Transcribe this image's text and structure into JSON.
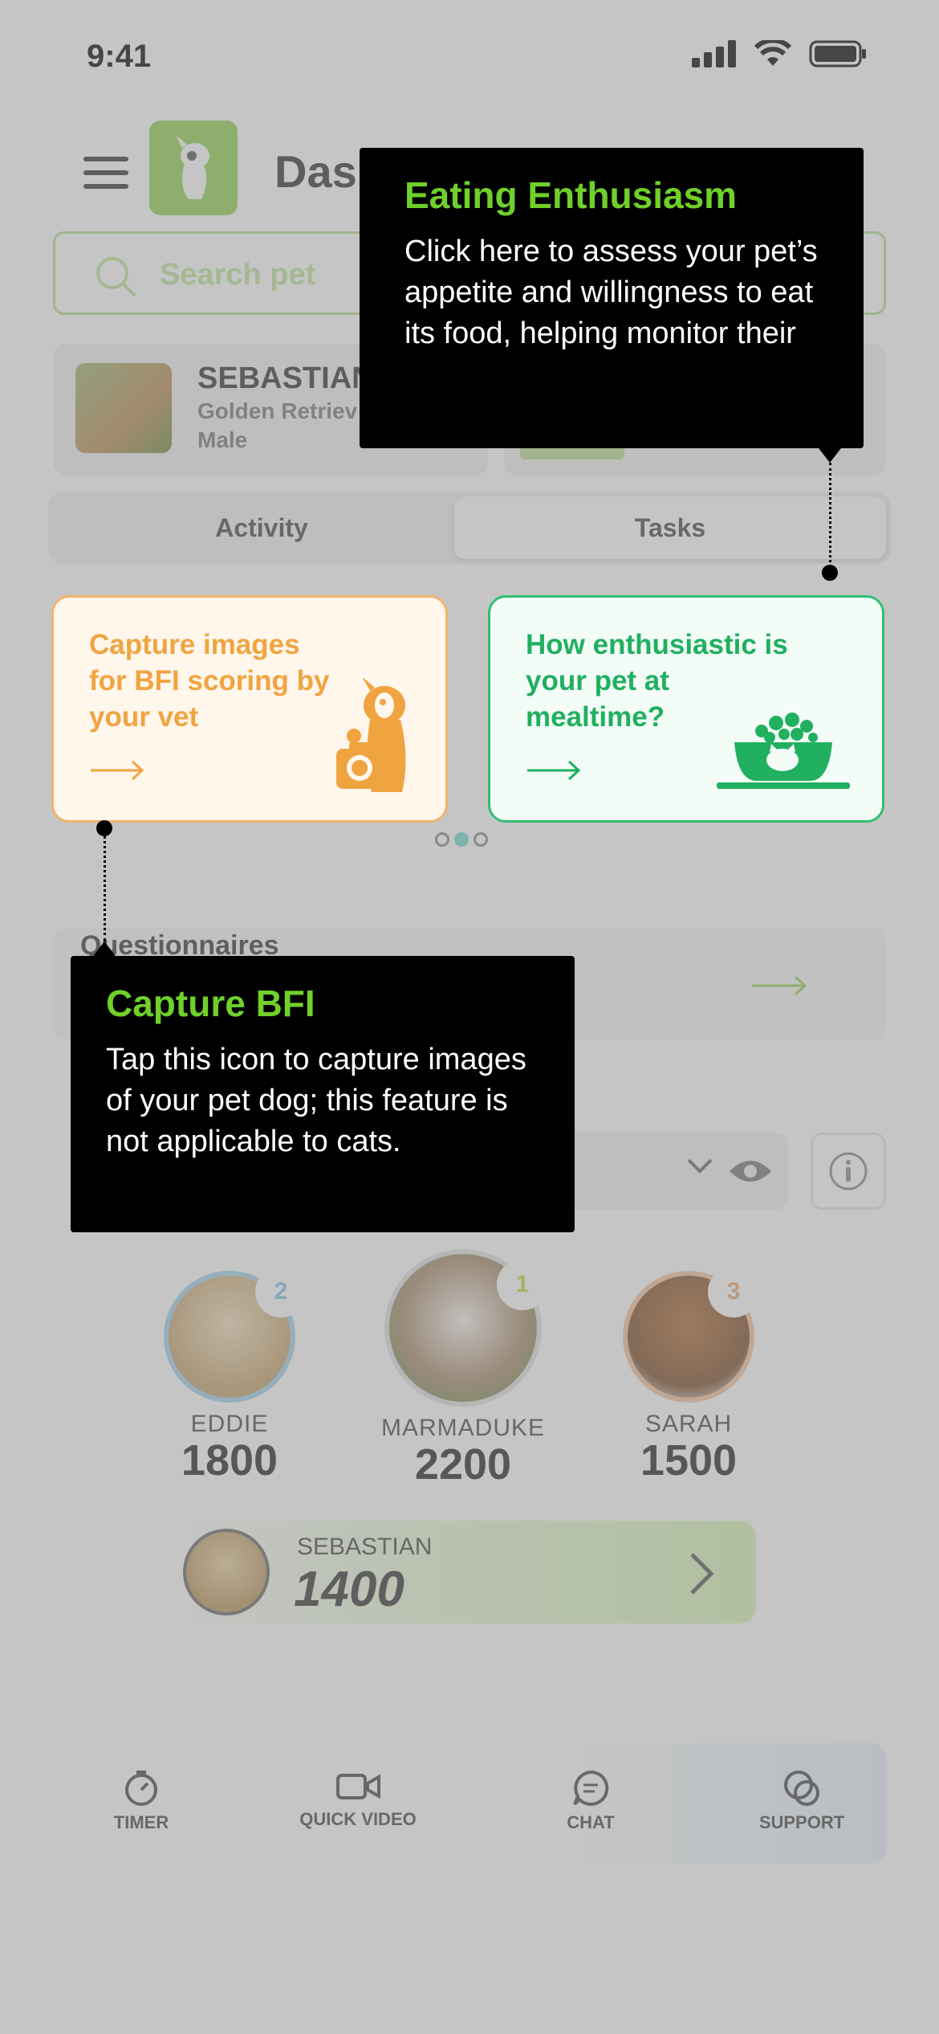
{
  "status_bar": {
    "time": "9:41"
  },
  "header": {
    "title": "Dashboard",
    "title_visible": "Dash"
  },
  "search": {
    "placeholder": "Search pet"
  },
  "pet_card": {
    "name": "SEBASTIAN",
    "breed": "Golden Retriev",
    "sex": "Male"
  },
  "tabs": [
    {
      "label": "Activity"
    },
    {
      "label": "Tasks"
    }
  ],
  "feature_cards": [
    {
      "text": "Capture images for BFI scoring by your vet",
      "accent": "#f0a440"
    },
    {
      "text": "How enthusiastic is your pet at mealtime?",
      "accent": "#20b060"
    }
  ],
  "carousel": {
    "pages": 3,
    "active_page": 2
  },
  "questionnaires": {
    "title": "Questionnaires"
  },
  "leaderboard": [
    {
      "rank": "2",
      "name": "EDDIE",
      "score": "1800"
    },
    {
      "rank": "1",
      "name": "MARMADUKE",
      "score": "2200"
    },
    {
      "rank": "3",
      "name": "SARAH",
      "score": "1500"
    }
  ],
  "current_user": {
    "name": "SEBASTIAN",
    "score": "1400"
  },
  "bottom_nav": [
    {
      "label": "TIMER",
      "icon": "timer-icon"
    },
    {
      "label": "QUICK VIDEO",
      "icon": "video-icon"
    },
    {
      "label": "CHAT",
      "icon": "chat-icon"
    },
    {
      "label": "SUPPORT",
      "icon": "support-icon"
    }
  ],
  "tooltips": {
    "eating": {
      "title": "Eating Enthusiasm",
      "body": "Click here to assess your pet’s appetite and willingness to eat its food, helping monitor their"
    },
    "bfi": {
      "title": "Capture BFI",
      "body": "Tap this icon to capture images of your pet dog; this feature is not applicable to cats."
    }
  },
  "colors": {
    "brand_green": "#6fd02a",
    "bfi_orange": "#f0a440",
    "eat_green": "#20b060",
    "tooltip_bg": "#000000"
  }
}
